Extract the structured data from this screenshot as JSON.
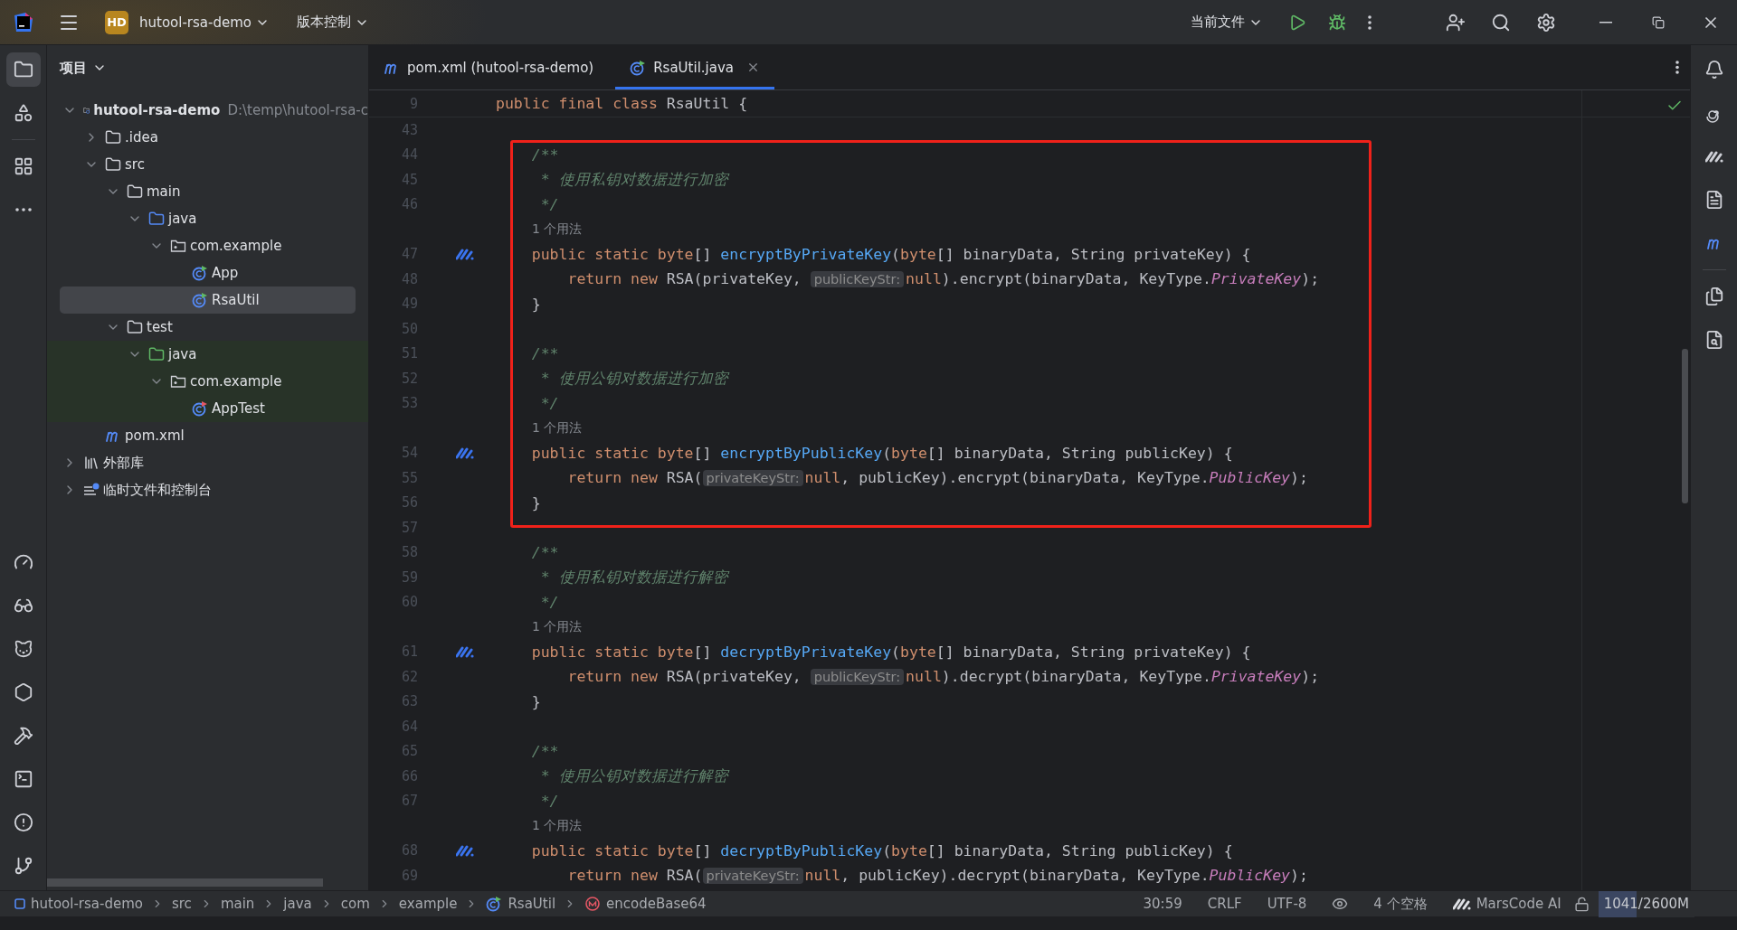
{
  "title_bar": {
    "badge": "HD",
    "project": "hutool-rsa-demo",
    "vcs": "版本控制",
    "run_config": "当前文件"
  },
  "project_panel": {
    "title": "项目",
    "tree": [
      {
        "label": "hutool-rsa-demo",
        "kind": "module",
        "path": "D:\\temp\\hutool-rsa-c",
        "expanded": true,
        "selected": false,
        "children": [
          {
            "label": ".idea",
            "kind": "folder",
            "expanded": false,
            "selected": false
          },
          {
            "label": "src",
            "kind": "folder",
            "expanded": true,
            "selected": false,
            "children": [
              {
                "label": "main",
                "kind": "folder",
                "expanded": true,
                "selected": false,
                "children": [
                  {
                    "label": "java",
                    "kind": "source-folder",
                    "expanded": true,
                    "selected": false,
                    "children": [
                      {
                        "label": "com.example",
                        "kind": "package",
                        "expanded": true,
                        "selected": false,
                        "children": [
                          {
                            "label": "App",
                            "kind": "class",
                            "selected": false
                          },
                          {
                            "label": "RsaUtil",
                            "kind": "class",
                            "selected": true
                          }
                        ]
                      }
                    ]
                  }
                ]
              },
              {
                "label": "test",
                "kind": "folder",
                "expanded": true,
                "selected": false,
                "children": [
                  {
                    "label": "java",
                    "kind": "test-folder",
                    "expanded": true,
                    "selected": false,
                    "children": [
                      {
                        "label": "com.example",
                        "kind": "package",
                        "expanded": true,
                        "selected": false,
                        "children": [
                          {
                            "label": "AppTest",
                            "kind": "test-class",
                            "selected": false
                          }
                        ]
                      }
                    ]
                  }
                ]
              }
            ]
          },
          {
            "label": "pom.xml",
            "kind": "maven",
            "selected": false
          }
        ]
      },
      {
        "label": "外部库",
        "kind": "library",
        "expanded": false,
        "selected": false
      },
      {
        "label": "临时文件和控制台",
        "kind": "scratch",
        "expanded": false,
        "selected": false
      }
    ]
  },
  "tabs": [
    {
      "label": "pom.xml (hutool-rsa-demo)",
      "kind": "maven",
      "selected": false
    },
    {
      "label": "RsaUtil.java",
      "kind": "class",
      "selected": true
    }
  ],
  "editor": {
    "sticky_line": {
      "number": "9",
      "tokens": [
        {
          "kind": "kw",
          "text": "public final class "
        },
        {
          "kind": "plain",
          "text": "RsaUtil {"
        }
      ]
    },
    "sections": [
      {
        "framed": false,
        "lines": [
          {
            "number": "43"
          }
        ]
      },
      {
        "framed": true,
        "lines": [
          {
            "number": "44",
            "tokens": [
              {
                "kind": "doc",
                "text": "    /**"
              }
            ]
          },
          {
            "number": "45",
            "tokens": [
              {
                "kind": "doc",
                "text": "     * 使用私钥对数据进行加密"
              }
            ]
          },
          {
            "number": "46",
            "tokens": [
              {
                "kind": "doc",
                "text": "     */"
              }
            ]
          },
          {
            "usage": "1 个用法"
          },
          {
            "number": "47",
            "ai_mark": true,
            "tokens": [
              {
                "kind": "kw",
                "text": "    public static byte"
              },
              {
                "kind": "plain",
                "text": "[] "
              },
              {
                "kind": "decl",
                "text": "encryptByPrivateKey"
              },
              {
                "kind": "plain",
                "text": "("
              },
              {
                "kind": "kw",
                "text": "byte"
              },
              {
                "kind": "plain",
                "text": "[] binaryData, String privateKey) {"
              }
            ]
          },
          {
            "number": "48",
            "tokens": [
              {
                "kind": "kw",
                "text": "        return new "
              },
              {
                "kind": "plain",
                "text": "RSA(privateKey, "
              },
              {
                "kind": "hint",
                "text": "publicKeyStr:"
              },
              {
                "kind": "kw",
                "text": "null"
              },
              {
                "kind": "plain",
                "text": ").encrypt(binaryData, KeyType."
              },
              {
                "kind": "static",
                "text": "PrivateKey"
              },
              {
                "kind": "plain",
                "text": ");"
              }
            ]
          },
          {
            "number": "49",
            "tokens": [
              {
                "kind": "plain",
                "text": "    }"
              }
            ]
          },
          {
            "number": "50"
          },
          {
            "number": "51",
            "tokens": [
              {
                "kind": "doc",
                "text": "    /**"
              }
            ]
          },
          {
            "number": "52",
            "tokens": [
              {
                "kind": "doc",
                "text": "     * 使用公钥对数据进行加密"
              }
            ]
          },
          {
            "number": "53",
            "tokens": [
              {
                "kind": "doc",
                "text": "     */"
              }
            ]
          },
          {
            "usage": "1 个用法"
          },
          {
            "number": "54",
            "ai_mark": true,
            "tokens": [
              {
                "kind": "kw",
                "text": "    public static byte"
              },
              {
                "kind": "plain",
                "text": "[] "
              },
              {
                "kind": "decl",
                "text": "encryptByPublicKey"
              },
              {
                "kind": "plain",
                "text": "("
              },
              {
                "kind": "kw",
                "text": "byte"
              },
              {
                "kind": "plain",
                "text": "[] binaryData, String publicKey) {"
              }
            ]
          },
          {
            "number": "55",
            "tokens": [
              {
                "kind": "kw",
                "text": "        return new "
              },
              {
                "kind": "plain",
                "text": "RSA("
              },
              {
                "kind": "hint",
                "text": "privateKeyStr:"
              },
              {
                "kind": "kw",
                "text": "null"
              },
              {
                "kind": "plain",
                "text": ", publicKey).encrypt(binaryData, KeyType."
              },
              {
                "kind": "static",
                "text": "PublicKey"
              },
              {
                "kind": "plain",
                "text": ");"
              }
            ]
          },
          {
            "number": "56",
            "tokens": [
              {
                "kind": "plain",
                "text": "    }"
              }
            ]
          }
        ]
      },
      {
        "framed": false,
        "lines": [
          {
            "number": "57"
          },
          {
            "number": "58",
            "tokens": [
              {
                "kind": "doc",
                "text": "    /**"
              }
            ]
          },
          {
            "number": "59",
            "tokens": [
              {
                "kind": "doc",
                "text": "     * 使用私钥对数据进行解密"
              }
            ]
          },
          {
            "number": "60",
            "tokens": [
              {
                "kind": "doc",
                "text": "     */"
              }
            ]
          },
          {
            "usage": "1 个用法"
          },
          {
            "number": "61",
            "ai_mark": true,
            "tokens": [
              {
                "kind": "kw",
                "text": "    public static byte"
              },
              {
                "kind": "plain",
                "text": "[] "
              },
              {
                "kind": "decl",
                "text": "decryptByPrivateKey"
              },
              {
                "kind": "plain",
                "text": "("
              },
              {
                "kind": "kw",
                "text": "byte"
              },
              {
                "kind": "plain",
                "text": "[] binaryData, String privateKey) {"
              }
            ]
          },
          {
            "number": "62",
            "tokens": [
              {
                "kind": "kw",
                "text": "        return new "
              },
              {
                "kind": "plain",
                "text": "RSA(privateKey, "
              },
              {
                "kind": "hint",
                "text": "publicKeyStr:"
              },
              {
                "kind": "kw",
                "text": "null"
              },
              {
                "kind": "plain",
                "text": ").decrypt(binaryData, KeyType."
              },
              {
                "kind": "static",
                "text": "PrivateKey"
              },
              {
                "kind": "plain",
                "text": ");"
              }
            ]
          },
          {
            "number": "63",
            "tokens": [
              {
                "kind": "plain",
                "text": "    }"
              }
            ]
          },
          {
            "number": "64"
          },
          {
            "number": "65",
            "tokens": [
              {
                "kind": "doc",
                "text": "    /**"
              }
            ]
          },
          {
            "number": "66",
            "tokens": [
              {
                "kind": "doc",
                "text": "     * 使用公钥对数据进行解密"
              }
            ]
          },
          {
            "number": "67",
            "tokens": [
              {
                "kind": "doc",
                "text": "     */"
              }
            ]
          },
          {
            "usage": "1 个用法"
          },
          {
            "number": "68",
            "ai_mark": true,
            "tokens": [
              {
                "kind": "kw",
                "text": "    public static byte"
              },
              {
                "kind": "plain",
                "text": "[] "
              },
              {
                "kind": "decl",
                "text": "decryptByPublicKey"
              },
              {
                "kind": "plain",
                "text": "("
              },
              {
                "kind": "kw",
                "text": "byte"
              },
              {
                "kind": "plain",
                "text": "[] binaryData, String publicKey) {"
              }
            ]
          },
          {
            "number": "69",
            "tokens": [
              {
                "kind": "kw",
                "text": "        return new "
              },
              {
                "kind": "plain",
                "text": "RSA("
              },
              {
                "kind": "hint",
                "text": "privateKeyStr:"
              },
              {
                "kind": "kw",
                "text": "null"
              },
              {
                "kind": "plain",
                "text": ", publicKey).decrypt(binaryData, KeyType."
              },
              {
                "kind": "static",
                "text": "PublicKey"
              },
              {
                "kind": "plain",
                "text": ");"
              }
            ]
          }
        ]
      }
    ]
  },
  "status_bar": {
    "breadcrumbs": [
      {
        "text": "hutool-rsa-demo",
        "kind": "module"
      },
      {
        "text": "src",
        "kind": "folder"
      },
      {
        "text": "main",
        "kind": "folder"
      },
      {
        "text": "java",
        "kind": "folder"
      },
      {
        "text": "com",
        "kind": "folder"
      },
      {
        "text": "example",
        "kind": "folder"
      },
      {
        "text": "RsaUtil",
        "kind": "class"
      },
      {
        "text": "encodeBase64",
        "kind": "method"
      }
    ],
    "position": "30:59",
    "line_separator": "CRLF",
    "encoding": "UTF-8",
    "indent": "4 个空格",
    "assistant": "MarsCode AI",
    "memory": {
      "text": "1041/2600M",
      "level": 0.4
    }
  }
}
